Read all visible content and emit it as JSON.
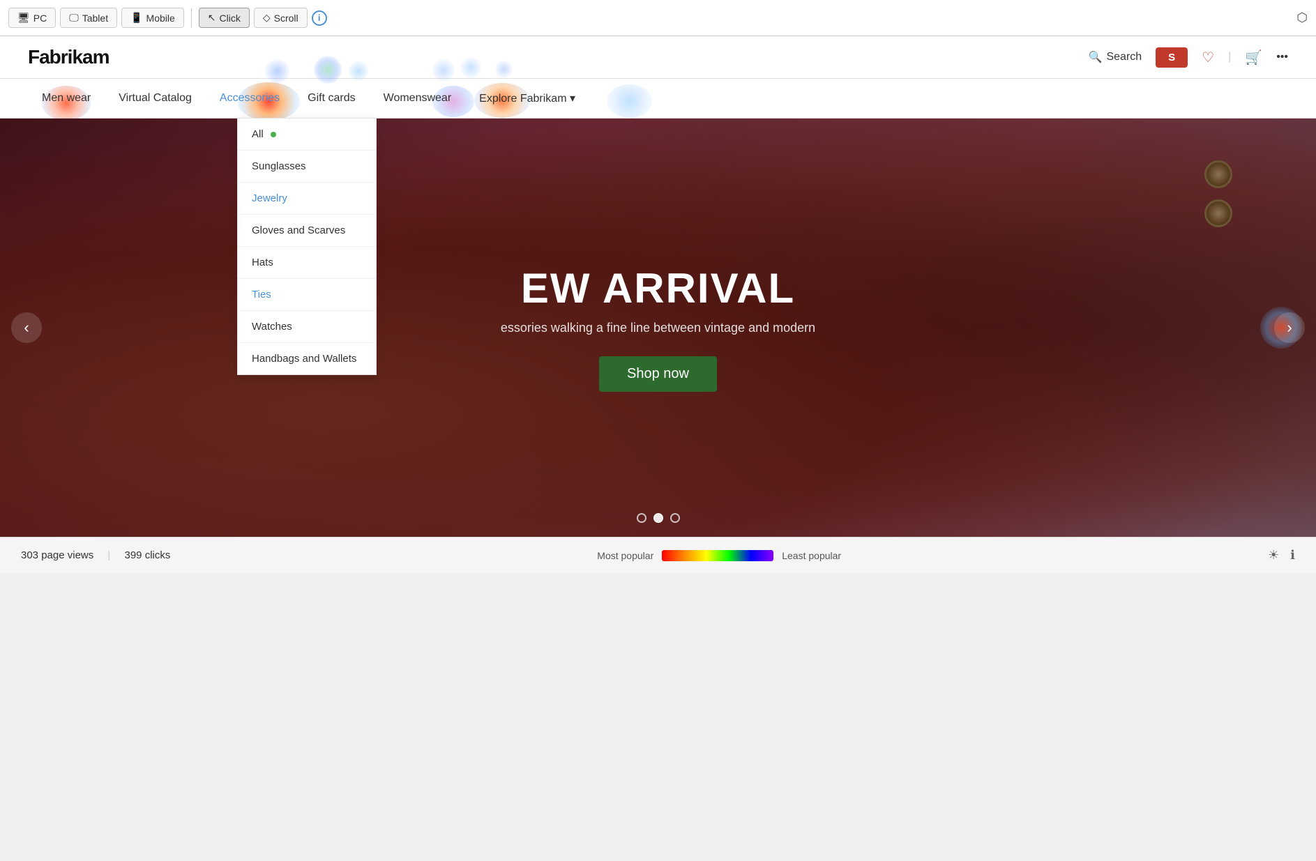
{
  "toolbar": {
    "pc_label": "PC",
    "tablet_label": "Tablet",
    "mobile_label": "Mobile",
    "click_label": "Click",
    "scroll_label": "Scroll",
    "info_label": "i"
  },
  "header": {
    "logo": "Fabrikam",
    "search_label": "Search",
    "signin_label": "S",
    "share_icon": "⎋"
  },
  "nav": {
    "items": [
      {
        "label": "Men wear",
        "active": false
      },
      {
        "label": "Virtual Catalog",
        "active": false
      },
      {
        "label": "Accessories",
        "active": true
      },
      {
        "label": "Gift cards",
        "active": false
      },
      {
        "label": "Womenswear",
        "active": false
      },
      {
        "label": "Explore Fabrikam ▾",
        "active": false
      }
    ]
  },
  "dropdown": {
    "items": [
      {
        "label": "All",
        "highlighted": false
      },
      {
        "label": "Sunglasses",
        "highlighted": false
      },
      {
        "label": "Jewelry",
        "highlighted": true
      },
      {
        "label": "Gloves and Scarves",
        "highlighted": false
      },
      {
        "label": "Hats",
        "highlighted": false
      },
      {
        "label": "Ties",
        "highlighted": true
      },
      {
        "label": "Watches",
        "highlighted": false
      },
      {
        "label": "Handbags and Wallets",
        "highlighted": false
      }
    ]
  },
  "hero": {
    "eyebrow": "NEW ARRIVAL",
    "title": "EW ARRIVAL",
    "description": "essories walking a fine line between vintage and modern",
    "cta_label": "Shop now"
  },
  "footer": {
    "page_views_label": "303 page views",
    "clicks_label": "399 clicks",
    "most_popular": "Most popular",
    "least_popular": "Least popular"
  }
}
